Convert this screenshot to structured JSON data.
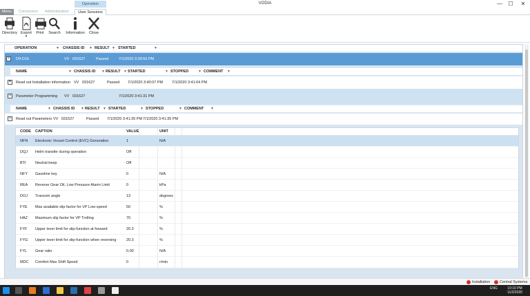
{
  "window": {
    "title": "VODIA",
    "minimize": "—",
    "maximize": "☐",
    "close": "✕"
  },
  "tabs": {
    "menu": "Menu",
    "connection": "Connection",
    "administration": "Administration",
    "context_group": "Operation",
    "user_sessions": "User Sessions"
  },
  "ribbon": {
    "buttons": [
      {
        "label": "Directory",
        "icon": "printer-icon"
      },
      {
        "label": "Export",
        "icon": "pdf-export-icon",
        "dropdown": "▾"
      },
      {
        "label": "Print",
        "icon": "print-icon"
      },
      {
        "label": "Search",
        "icon": "search-icon"
      },
      {
        "label": "Information",
        "icon": "info-icon"
      },
      {
        "label": "Close",
        "icon": "close-icon"
      }
    ]
  },
  "grid": {
    "headers": [
      "OPERATION",
      "CHASSIS ID",
      "RESULT",
      "STARTED"
    ],
    "top_row": {
      "operation": "D9-D16",
      "chassis": "VV",
      "chassis_id": "031627",
      "result": "Passed",
      "started": "7/1/2020 3:39:50 PM"
    },
    "sub_headers": [
      "NAME",
      "CHASSIS ID",
      "RESULT",
      "STARTED",
      "STOPPED",
      "COMMENT"
    ],
    "sub_rows": [
      {
        "name": "Read out Installation information",
        "chassis": "VV",
        "chassis_id": "031627",
        "result": "Passed",
        "started": "7/1/2020 3:40:07 PM",
        "stopped": "7/1/2020 3:41:04 PM",
        "expander": "+"
      },
      {
        "name": "Parameter Programming",
        "chassis": "VV",
        "chassis_id": "031627",
        "result": "",
        "started": "7/1/2020 3:41:31 PM",
        "stopped": "",
        "expander": "−"
      }
    ],
    "sub2_headers": [
      "NAME",
      "CHASSIS ID",
      "RESULT",
      "STARTED",
      "STOPPED",
      "COMMENT"
    ],
    "sub2_row": {
      "name": "Read out Parameters",
      "chassis": "VV",
      "chassis_id": "031627",
      "result": "Passed",
      "started": "7/1/2020 3:41:35 PM",
      "stopped": "7/1/2020 3:41:35 PM",
      "expander": "−"
    }
  },
  "params": {
    "headers": [
      "CODE",
      "CAPTION",
      "VALUE",
      "UNIT"
    ],
    "rows": [
      {
        "code": "NFN",
        "caption": "Electronic Vessel Control (EVC) Generation",
        "value": "1",
        "unit": "N/A"
      },
      {
        "code": "DQJ",
        "caption": "Helm transfer during operation",
        "value": "Off",
        "unit": ""
      },
      {
        "code": "BTI",
        "caption": "Neutral beep",
        "value": "Off",
        "unit": ""
      },
      {
        "code": "NFY",
        "caption": "Gasoline key",
        "value": "0",
        "unit": "N/A"
      },
      {
        "code": "REA",
        "caption": "Reverse Gear Oil, Low Pressure Alarm Limit",
        "value": "0",
        "unit": "kPa"
      },
      {
        "code": "DOJ",
        "caption": "Transom angle",
        "value": "13",
        "unit": "degrees"
      },
      {
        "code": "FYE",
        "caption": "Max available slip factor for VP Low-speed",
        "value": "50",
        "unit": "%"
      },
      {
        "code": "HAZ",
        "caption": "Maximum slip factor for VP Trolling",
        "value": "70",
        "unit": "%"
      },
      {
        "code": "FYF",
        "caption": "Upper lever limit for slip-function at forward",
        "value": "20.3",
        "unit": "%"
      },
      {
        "code": "FYG",
        "caption": "Upper lever limit for slip-function when reversing",
        "value": "20.3",
        "unit": "%"
      },
      {
        "code": "FYL",
        "caption": "Gear ratio",
        "value": "0.00",
        "unit": "N/A"
      },
      {
        "code": "MDC",
        "caption": "Comfort Max Shift Speed",
        "value": "0",
        "unit": "r/min"
      }
    ]
  },
  "status": {
    "installation": "Installation",
    "central": "Central Systems"
  },
  "taskbar": {
    "lang": "ENG",
    "time": "10:10 PM",
    "date": "11/2/2020"
  },
  "colors": {
    "accent": "#5b9bd5",
    "pane": "#d9e6f1",
    "selected": "#cde0f1"
  }
}
